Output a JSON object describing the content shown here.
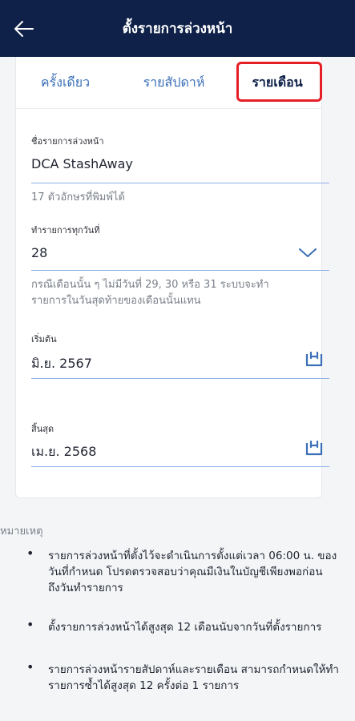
{
  "header": {
    "title": "ตั้งรายการล่วงหน้า",
    "back_icon": "arrow-left-icon"
  },
  "tabs": [
    {
      "label": "ครั้งเดียว",
      "active": false
    },
    {
      "label": "รายสัปดาห์",
      "active": false
    },
    {
      "label": "รายเดือน",
      "active": true
    }
  ],
  "form": {
    "name": {
      "label": "ชื่อรายการล่วงหน้า",
      "value": "DCA StashAway",
      "hint": "17 ตัวอักษรที่พิมพ์ได้"
    },
    "day": {
      "label": "ทำรายการทุกวันที่",
      "value": "28",
      "hint_line1": "กรณีเดือนนั้น ๆ ไม่มีวันที่ 29, 30 หรือ 31 ระบบจะทำ",
      "hint_line2": "รายการในวันสุดท้ายของเดือนนั้นแทน"
    },
    "start": {
      "label": "เริ่มต้น",
      "value": "มิ.ย. 2567"
    },
    "end": {
      "label": "สิ้นสุด",
      "value": "เม.ย. 2568"
    }
  },
  "notes": {
    "title": "หมายเหตุ",
    "items": [
      {
        "line1": "รายการล่วงหน้าที่ตั้งไว้จะดำเนินการตั้งแต่เวลา 06:00 น. ของ",
        "line2": "วันที่กำหนด โปรดตรวจสอบว่าคุณมีเงินในบัญชีเพียงพอก่อน",
        "line3": "ถึงวันทำรายการ"
      },
      {
        "line1": "ตั้งรายการล่วงหน้าได้สูงสุด 12 เดือนนับจากวันที่ตั้งรายการ"
      },
      {
        "line1": "รายการล่วงหน้ารายสัปดาห์และรายเดือน สามารถกำหนดให้ทำ",
        "line2": "รายการซ้ำได้สูงสุด 12 ครั้งต่อ 1 รายการ"
      }
    ]
  },
  "colors": {
    "header_bg": "#0f2148",
    "accent": "#3b6fb7",
    "highlight": "#e61e26"
  }
}
